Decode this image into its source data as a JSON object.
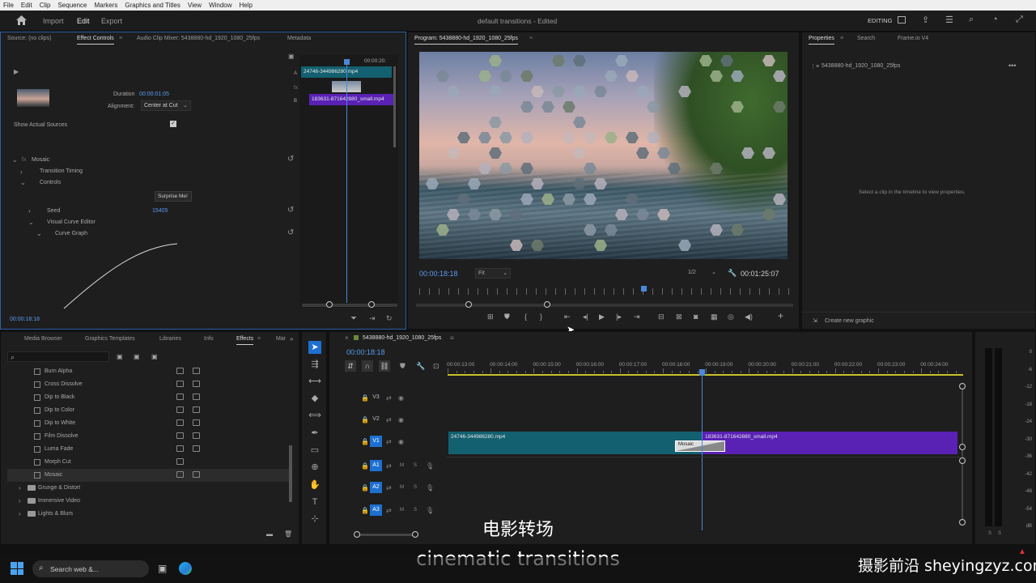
{
  "menu": [
    "File",
    "Edit",
    "Clip",
    "Sequence",
    "Markers",
    "Graphics and Titles",
    "View",
    "Window",
    "Help"
  ],
  "appbar": {
    "import": "Import",
    "edit": "Edit",
    "export": "Export",
    "title": "default transitions - Edited",
    "workspace": "EDITING"
  },
  "source": {
    "tabs": [
      "Source: (no clips)",
      "Effect Controls",
      "Audio Clip Mixer: 5438880-hd_1920_1080_25fps",
      "Metadata"
    ],
    "duration_label": "Duration",
    "duration": "00:00:01:05",
    "alignment_label": "Alignment:",
    "alignment": "Center at Cut",
    "show_sources": "Show Actual Sources",
    "mosaic": "Mosaic",
    "transition_timing": "Transition Timing",
    "controls": "Controls",
    "surprise": "Surprise Me!",
    "seed_label": "Seed",
    "seed": "15405",
    "curve_editor": "Visual Curve Editor",
    "curve_graph": "Curve Graph",
    "timecode": "00:00:18:18",
    "mini_time": "00:00:20:",
    "clip_a": "24746-344986280.mp4",
    "clip_b": "183631-871642880_small.mp4",
    "track_a": "A",
    "track_b": "B"
  },
  "program": {
    "title": "Program: 5438880-hd_1920_1080_25fps",
    "timecode": "00:00:18:18",
    "fit": "Fit",
    "quality": "1/2",
    "duration": "00:01:25:07"
  },
  "properties": {
    "tabs": [
      "Properties",
      "Search",
      "Frame.io V4"
    ],
    "clip": "5438880-hd_1920_1080_25fps",
    "empty": "Select a clip in the timeline to view properties.",
    "create": "Create new graphic"
  },
  "effects": {
    "tabs": [
      "Media Browser",
      "Graphics Templates",
      "Libraries",
      "Info",
      "Effects",
      "Mar"
    ],
    "items": [
      "Burn Alpha",
      "Cross Dissolve",
      "Dip to Black",
      "Dip to Color",
      "Dip to White",
      "Film Dissolve",
      "Luma Fade",
      "Morph Cut",
      "Mosaic"
    ],
    "folders": [
      "Grunge & Distort",
      "Immersive Video",
      "Lights & Blurs"
    ]
  },
  "timeline": {
    "title": "5438880-hd_1920_1080_25fps",
    "timecode": "00:00:18:18",
    "ticks": [
      "00:00:13:00",
      "00:00:14:00",
      "00:00:15:00",
      "00:00:16:00",
      "00:00:17:00",
      "00:00:18:00",
      "00:00:19:00",
      "00:00:20:00",
      "00:00:21:00",
      "00:00:22:00",
      "00:00:23:00",
      "00:00:24:00"
    ],
    "tracks": [
      "V3",
      "V2",
      "V1",
      "A1",
      "A2",
      "A3"
    ],
    "clip1": "24746-344986280.mp4",
    "clip2": "183631-871642880_small.mp4",
    "transition": "Mosaic"
  },
  "meter": {
    "scale": [
      "0",
      "-6",
      "-12",
      "-18",
      "-24",
      "-30",
      "-36",
      "-42",
      "-48",
      "-54",
      "dB"
    ],
    "foot": [
      "S",
      "S"
    ]
  },
  "subtitle": {
    "zh": "电影转场",
    "en": "cinematic transitions"
  },
  "watermark": {
    "text": "摄影前沿 sheyingzyz.com"
  },
  "taskbar": {
    "search": "Search web &..."
  }
}
